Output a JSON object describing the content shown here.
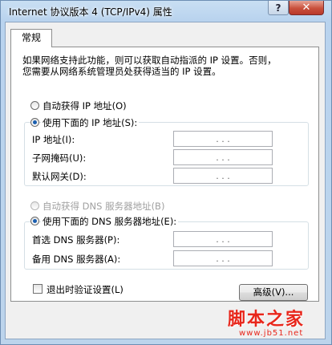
{
  "window": {
    "title": "Internet 协议版本 4 (TCP/IPv4) 属性",
    "help_label": "?",
    "close_label": "✕"
  },
  "tab": {
    "label": "常规"
  },
  "description": {
    "line1": "如果网络支持此功能，则可以获取自动指派的 IP 设置。否则，",
    "line2": "您需要从网络系统管理员处获得适当的 IP 设置。"
  },
  "ip_section": {
    "auto_label": "自动获得 IP 地址(O)",
    "manual_label": "使用下面的 IP 地址(S):",
    "auto_selected": false,
    "fields": [
      {
        "label": "IP 地址(I):",
        "value": ". . ."
      },
      {
        "label": "子网掩码(U):",
        "value": ". . ."
      },
      {
        "label": "默认网关(D):",
        "value": ". . ."
      }
    ]
  },
  "dns_section": {
    "auto_label": "自动获得 DNS 服务器地址(B)",
    "manual_label": "使用下面的 DNS 服务器地址(E):",
    "fields": [
      {
        "label": "首选 DNS 服务器(P):",
        "value": ". . ."
      },
      {
        "label": "备用 DNS 服务器(A):",
        "value": ". . ."
      }
    ]
  },
  "footer": {
    "validate_label": "退出时验证设置(L)",
    "advanced_label": "高级(V)..."
  },
  "watermark": {
    "title": "脚本之家",
    "url": "www.jb51.net"
  },
  "colors": {
    "title_bar": "#bcd4ec",
    "close_button": "#c9503c",
    "radio_dot": "#1b5fb0",
    "watermark": "#e8261b"
  }
}
